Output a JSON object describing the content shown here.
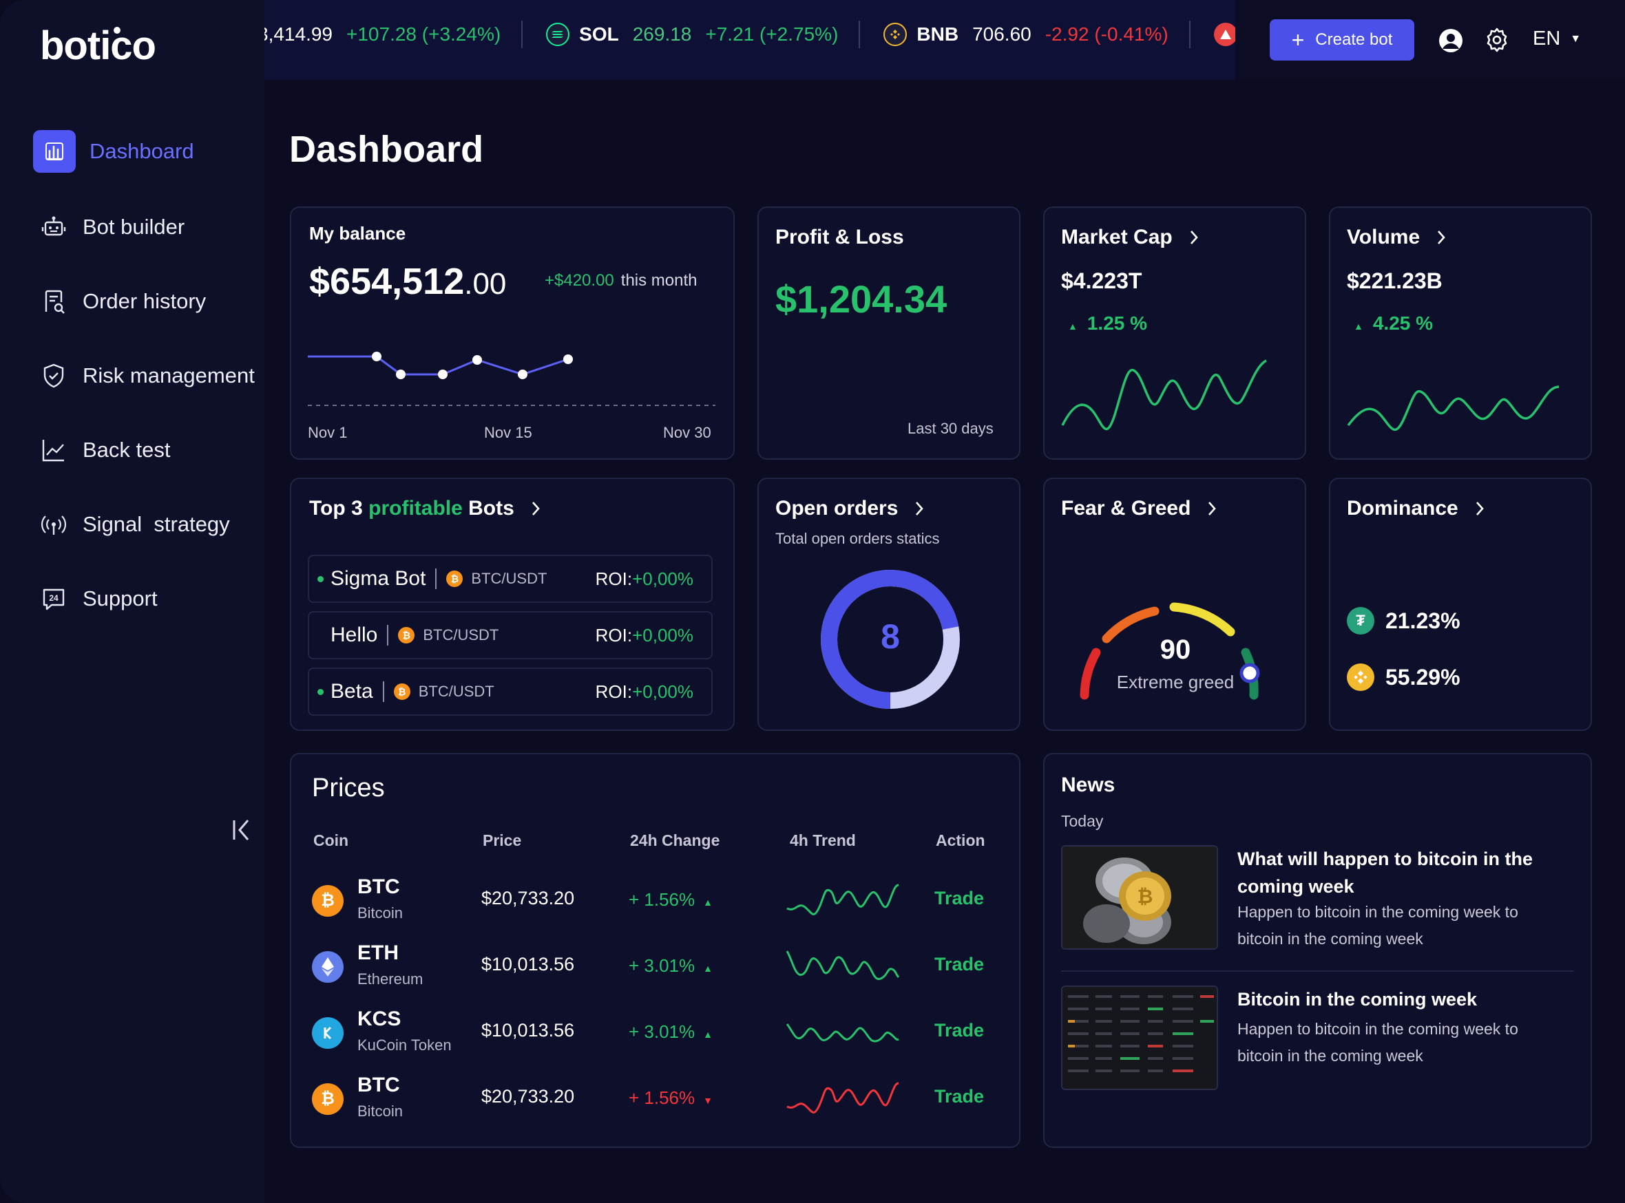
{
  "app": {
    "brand": "botico",
    "accent": "#4f56f4",
    "positive": "#27c26b",
    "negative": "#f2363b"
  },
  "sidebar": {
    "items": [
      {
        "label": "Dashboard",
        "icon": "bar-chart-icon",
        "active": true
      },
      {
        "label": "Bot builder",
        "icon": "robot-icon"
      },
      {
        "label": "Order history",
        "icon": "receipt-search-icon"
      },
      {
        "label": "Risk management",
        "icon": "shield-check-icon"
      },
      {
        "label": "Back test",
        "icon": "trend-line-icon"
      },
      {
        "label": "Signal  strategy",
        "icon": "signal-broadcast-icon"
      },
      {
        "label": "Support",
        "icon": "support-24-icon"
      }
    ],
    "collapse_icon": "collapse-left-icon"
  },
  "ticker": [
    {
      "symbol": "",
      "price": "3,414.99",
      "change": "+107.28 (+3.24%)",
      "direction": "up"
    },
    {
      "symbol": "SOL",
      "price": "269.18",
      "change": "+7.21 (+2.75%)",
      "direction": "up"
    },
    {
      "symbol": "BNB",
      "price": "706.60",
      "change": "-2.92 (-0.41%)",
      "direction": "down"
    }
  ],
  "header": {
    "create_bot": "Create bot",
    "language": "EN"
  },
  "page_title": "Dashboard",
  "balance": {
    "title": "My balance",
    "amount_main": "$654,512",
    "amount_cents": ".00",
    "change": "+$420.00",
    "change_period": "this month",
    "x_labels": [
      "Nov 1",
      "Nov 15",
      "Nov 30"
    ]
  },
  "profit_loss": {
    "title": "Profit & Loss",
    "amount": "$1,204.34",
    "period": "Last 30 days"
  },
  "market_cap": {
    "title": "Market Cap",
    "value": "$4.223T",
    "change": "1.25 %"
  },
  "volume": {
    "title": "Volume",
    "value": "$221.23B",
    "change": "4.25 %"
  },
  "top_bots": {
    "title_prefix": "Top 3",
    "title_highlight": "profitable",
    "title_suffix": "Bots",
    "roi_label": "ROI:",
    "items": [
      {
        "name": "Sigma Bot",
        "pair": "BTC/USDT",
        "roi": "+0,00%",
        "active": true
      },
      {
        "name": "Hello",
        "pair": "BTC/USDT",
        "roi": "+0,00%",
        "active": false
      },
      {
        "name": "Beta",
        "pair": "BTC/USDT",
        "roi": "+0,00%",
        "active": true
      }
    ]
  },
  "open_orders": {
    "title": "Open orders",
    "subtitle": "Total open orders statics",
    "count": "8",
    "fill_fraction": 0.72
  },
  "fear_greed": {
    "title": "Fear & Greed",
    "value": "90",
    "label": "Extreme greed"
  },
  "dominance": {
    "title": "Dominance",
    "items": [
      {
        "coin_icon": "tether-icon",
        "value": "21.23%",
        "color": "#26a17b"
      },
      {
        "coin_icon": "bnb-icon",
        "value": "55.29%",
        "color": "#f3ba2f"
      }
    ]
  },
  "prices": {
    "title": "Prices",
    "columns": [
      "Coin",
      "Price",
      "24h Change",
      "4h Trend",
      "Action"
    ],
    "rows": [
      {
        "symbol": "BTC",
        "name": "Bitcoin",
        "price": "$20,733.20",
        "change": "+ 1.56%",
        "direction": "up",
        "action": "Trade",
        "color": "#f7931a"
      },
      {
        "symbol": "ETH",
        "name": "Ethereum",
        "price": "$10,013.56",
        "change": "+ 3.01%",
        "direction": "up",
        "action": "Trade",
        "color": "#627eea"
      },
      {
        "symbol": "KCS",
        "name": "KuCoin Token",
        "price": "$10,013.56",
        "change": "+ 3.01%",
        "direction": "up",
        "action": "Trade",
        "color": "#23a7e0"
      },
      {
        "symbol": "BTC",
        "name": "Bitcoin",
        "price": "$20,733.20",
        "change": "+ 1.56%",
        "direction": "down",
        "action": "Trade",
        "color": "#f7931a"
      }
    ]
  },
  "news": {
    "title": "News",
    "section": "Today",
    "items": [
      {
        "headline": "What will happen to bitcoin in the coming week",
        "body": "Happen to bitcoin in the coming week to bitcoin in the coming week"
      },
      {
        "headline": "Bitcoin in the coming week",
        "body": "Happen to bitcoin in the coming week to bitcoin in the coming week"
      }
    ]
  }
}
